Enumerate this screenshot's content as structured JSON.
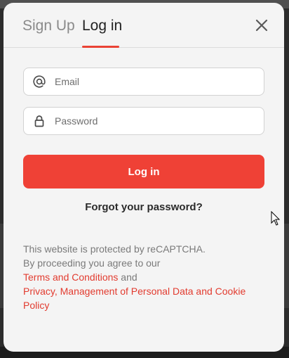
{
  "tabs": {
    "signup": "Sign Up",
    "login": "Log in"
  },
  "form": {
    "email_placeholder": "Email",
    "password_placeholder": "Password",
    "submit_label": "Log in",
    "forgot_label": "Forgot your password?"
  },
  "legal": {
    "line1": "This website is protected by reCAPTCHA.",
    "line2": "By proceeding you agree to our",
    "terms_link": "Terms and Conditions",
    "and_text": " and",
    "privacy_link": "Privacy, Management of Personal Data and Cookie Policy"
  },
  "colors": {
    "accent": "#ef4136",
    "link": "#e23b2f"
  },
  "icons": {
    "close": "close-icon",
    "email": "at-sign-icon",
    "password": "lock-icon"
  }
}
